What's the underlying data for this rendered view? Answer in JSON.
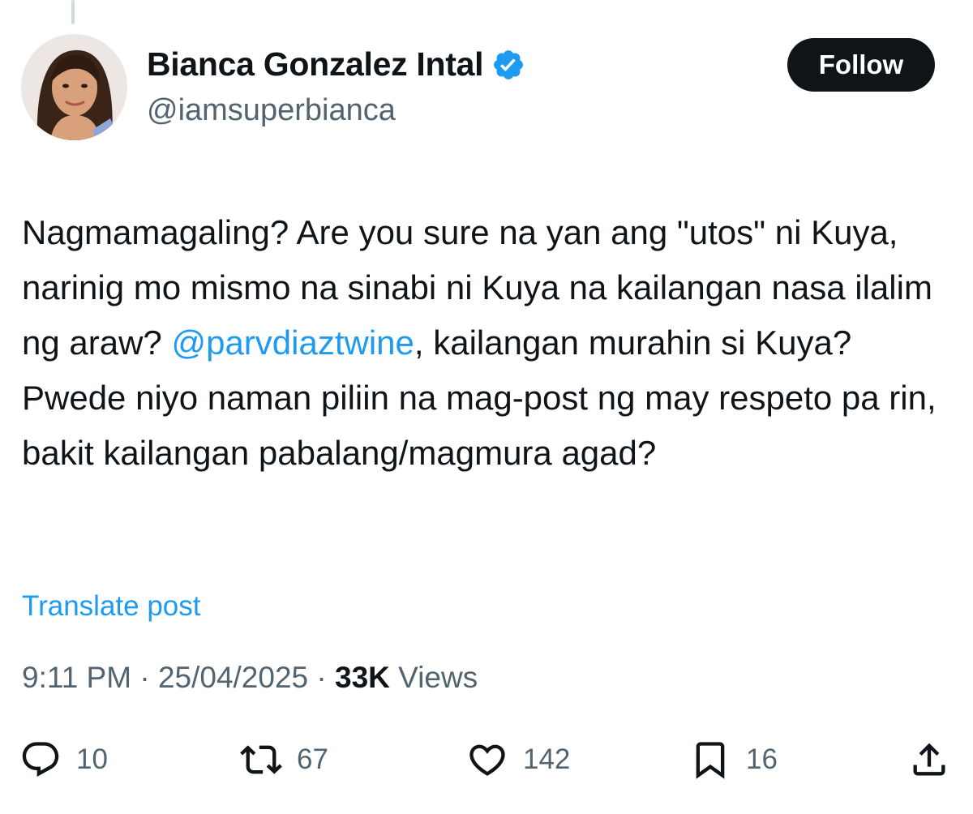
{
  "author": {
    "display_name": "Bianca Gonzalez Intal",
    "handle": "@iamsuperbianca",
    "verified": true
  },
  "follow_button": {
    "label": "Follow"
  },
  "tweet": {
    "text_before_mention": "Nagmamagaling? Are you sure na yan ang \"utos\" ni Kuya, narinig mo mismo na sinabi ni Kuya na kailangan nasa ilalim ng araw? ",
    "mention": "@parvdiaztwine",
    "text_after_mention": ", kailangan murahin si Kuya? Pwede niyo naman piliin na mag-post ng may respeto pa rin, bakit kailangan pabalang/magmura agad?"
  },
  "translate": {
    "label": "Translate post"
  },
  "meta": {
    "time": "9:11 PM",
    "separator": " · ",
    "date": "25/04/2025",
    "views_count": "33K",
    "views_label": " Views"
  },
  "actions": {
    "reply": {
      "icon": "reply-icon",
      "count": "10"
    },
    "repost": {
      "icon": "repost-icon",
      "count": "67"
    },
    "like": {
      "icon": "heart-icon",
      "count": "142"
    },
    "bookmark": {
      "icon": "bookmark-icon",
      "count": "16"
    },
    "share": {
      "icon": "share-icon"
    }
  },
  "colors": {
    "text": "#0f1419",
    "secondary": "#536471",
    "accent": "#1d9bf0",
    "button_bg": "#0f1419",
    "button_text": "#ffffff"
  }
}
